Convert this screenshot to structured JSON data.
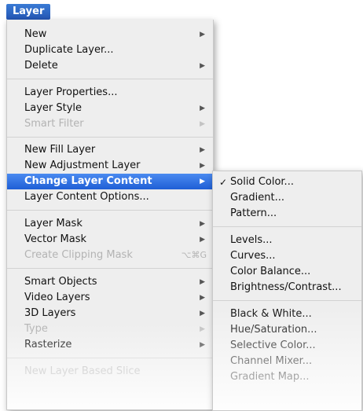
{
  "menubar": {
    "title": "Layer"
  },
  "menu": {
    "items": [
      {
        "label": "New",
        "submenu": true
      },
      {
        "label": "Duplicate Layer..."
      },
      {
        "label": "Delete",
        "submenu": true
      },
      {
        "label": "Layer Properties..."
      },
      {
        "label": "Layer Style",
        "submenu": true
      },
      {
        "label": "Smart Filter",
        "submenu": true,
        "disabled": true
      },
      {
        "label": "New Fill Layer",
        "submenu": true
      },
      {
        "label": "New Adjustment Layer",
        "submenu": true
      },
      {
        "label": "Change Layer Content",
        "submenu": true,
        "highlighted": true
      },
      {
        "label": "Layer Content Options..."
      },
      {
        "label": "Layer Mask",
        "submenu": true
      },
      {
        "label": "Vector Mask",
        "submenu": true
      },
      {
        "label": "Create Clipping Mask",
        "disabled": true,
        "shortcut": "⌥⌘G"
      },
      {
        "label": "Smart Objects",
        "submenu": true
      },
      {
        "label": "Video Layers",
        "submenu": true
      },
      {
        "label": "3D Layers",
        "submenu": true
      },
      {
        "label": "Type",
        "submenu": true,
        "disabled": true
      },
      {
        "label": "Rasterize",
        "submenu": true
      },
      {
        "label": "New Layer Based Slice",
        "disabled": true
      }
    ]
  },
  "submenu": {
    "items": [
      {
        "label": "Solid Color...",
        "checked": true
      },
      {
        "label": "Gradient..."
      },
      {
        "label": "Pattern..."
      },
      {
        "label": "Levels..."
      },
      {
        "label": "Curves..."
      },
      {
        "label": "Color Balance..."
      },
      {
        "label": "Brightness/Contrast..."
      },
      {
        "label": "Black & White..."
      },
      {
        "label": "Hue/Saturation..."
      },
      {
        "label": "Selective Color..."
      },
      {
        "label": "Channel Mixer..."
      },
      {
        "label": "Gradient Map..."
      }
    ]
  },
  "glyphs": {
    "arrow": "▶",
    "check": "✓"
  }
}
